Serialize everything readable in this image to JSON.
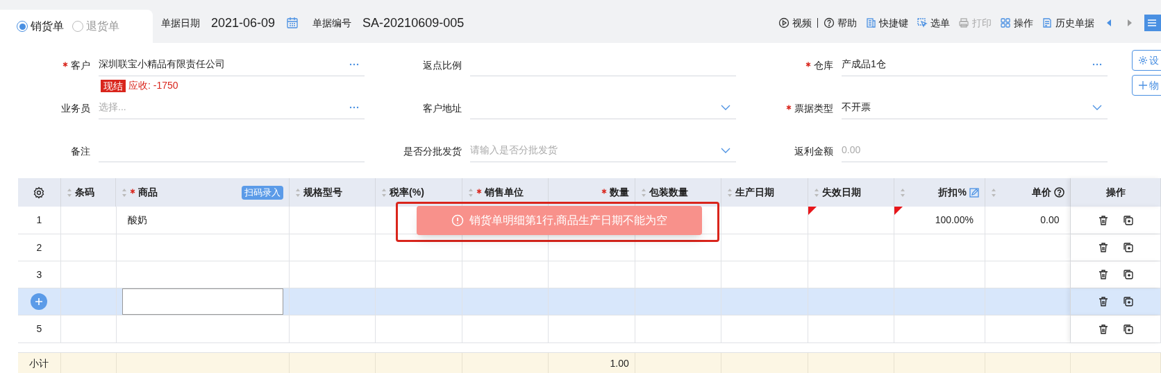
{
  "doc_type": [
    {
      "label": "销货单",
      "selected": true
    },
    {
      "label": "退货单",
      "selected": false
    }
  ],
  "header_fields": [
    {
      "label": "单据日期",
      "value": "2021-06-09",
      "kind": "date"
    },
    {
      "label": "单据编号",
      "value": "SA-20210609-005",
      "kind": "text"
    }
  ],
  "toolbar": [
    {
      "label": "视频",
      "kind": "play",
      "disabled": false
    },
    {
      "label": "帮助",
      "kind": "help",
      "disabled": false
    },
    {
      "label": "快捷键",
      "kind": "keys",
      "disabled": false
    },
    {
      "label": "选单",
      "kind": "pick",
      "disabled": false
    },
    {
      "label": "打印",
      "kind": "print",
      "disabled": true
    },
    {
      "label": "操作",
      "kind": "grid",
      "disabled": false
    },
    {
      "label": "历史单据",
      "kind": "history",
      "disabled": false
    }
  ],
  "form_rows": [
    [
      {
        "label": "客户",
        "required": true,
        "value": "深圳联宝小精品有限责任公司",
        "kind": "picker"
      },
      {
        "label": "返点比例",
        "required": false,
        "kind": "text"
      },
      {
        "label": "仓库",
        "required": true,
        "value": "产成品1仓",
        "kind": "picker"
      }
    ],
    [
      {
        "label": "业务员",
        "required": false,
        "placeholder": "选择...",
        "kind": "picker"
      },
      {
        "label": "客户地址",
        "required": false,
        "kind": "select"
      },
      {
        "label": "票据类型",
        "required": true,
        "value": "不开票",
        "kind": "select"
      }
    ],
    [
      {
        "label": "备注",
        "required": false,
        "kind": "text"
      },
      {
        "label": "是否分批发货",
        "required": false,
        "placeholder": "请输入是否分批发货",
        "kind": "select"
      },
      {
        "label": "返利金额",
        "required": false,
        "placeholder": "0.00",
        "kind": "text"
      }
    ]
  ],
  "customer_tag": {
    "badge": "现结",
    "text": "应收: -1750"
  },
  "side_buttons": [
    {
      "label": "设",
      "kind": "gear"
    },
    {
      "label": "物",
      "kind": "plus"
    }
  ],
  "table": {
    "columns": [
      {
        "label": "条码",
        "required": false,
        "sortable": true
      },
      {
        "label": "商品",
        "required": true,
        "sortable": true,
        "badge": "扫码录入"
      },
      {
        "label": "规格型号",
        "required": false,
        "sortable": true
      },
      {
        "label": "税率(%)",
        "required": false,
        "sortable": true
      },
      {
        "label": "销售单位",
        "required": true,
        "sortable": true
      },
      {
        "label": "数量",
        "required": true,
        "sortable": false
      },
      {
        "label": "包装数量",
        "required": false,
        "sortable": true
      },
      {
        "label": "生产日期",
        "required": false,
        "sortable": true
      },
      {
        "label": "失效日期",
        "required": false,
        "sortable": true
      },
      {
        "label": "折扣%",
        "required": false,
        "sortable": true,
        "kind": "editable"
      },
      {
        "label": "单价",
        "required": false,
        "sortable": true,
        "kind": "hint"
      },
      {
        "label": "操作",
        "required": false,
        "sortable": false
      }
    ],
    "rows": [
      {
        "kind": "data",
        "number": "1",
        "product": "酸奶",
        "discount": "100.00%",
        "unit_price": "0.00",
        "production_date_missing": true,
        "expiry_date_missing": true,
        "selected": false
      },
      {
        "kind": "data",
        "number": "2",
        "production_date_missing": false,
        "expiry_date_missing": false,
        "selected": false
      },
      {
        "kind": "data",
        "number": "3",
        "production_date_missing": false,
        "expiry_date_missing": false,
        "selected": false
      },
      {
        "kind": "new",
        "production_date_missing": false,
        "expiry_date_missing": false,
        "selected": true
      },
      {
        "kind": "data",
        "number": "5",
        "production_date_missing": false,
        "expiry_date_missing": false,
        "selected": false
      }
    ],
    "subtotal": {
      "label": "小计",
      "quantity": "1.00"
    }
  },
  "toast": {
    "message": "销货单明细第1行,商品生产日期不能为空"
  }
}
